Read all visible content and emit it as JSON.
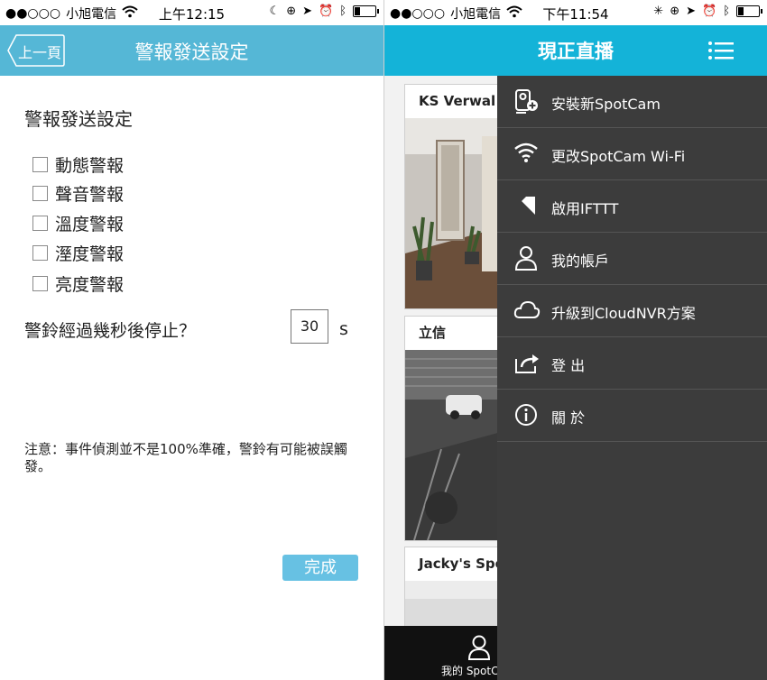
{
  "left": {
    "status": {
      "carrier": "小旭電信",
      "time": "上午12:15"
    },
    "nav": {
      "back": "上一頁",
      "title": "警報發送設定"
    },
    "section_title": "警報發送設定",
    "checkboxes": [
      "動態警報",
      "聲音警報",
      "溫度警報",
      "溼度警報",
      "亮度警報"
    ],
    "stop_question": "警鈴經過幾秒後停止？",
    "seconds_value": "30",
    "seconds_unit": "s",
    "note": "注意：事件偵測並不是100%準確，警鈴有可能被誤觸發。",
    "done": "完成"
  },
  "right": {
    "status": {
      "carrier": "小旭電信",
      "time": "下午11:54"
    },
    "nav": {
      "title": "現正直播"
    },
    "cameras": [
      {
        "title": "KS  Verwal"
      },
      {
        "title": "立信"
      },
      {
        "title": "Jacky's Spo"
      }
    ],
    "bottom_tab": "我的 SpotC",
    "menu": [
      {
        "label": "安裝新SpotCam",
        "icon": "add-camera-icon"
      },
      {
        "label": "更改SpotCam Wi-Fi",
        "icon": "wifi-icon"
      },
      {
        "label": "啟用IFTTT",
        "icon": "ifttt-icon"
      },
      {
        "label": "我的帳戶",
        "icon": "user-icon"
      },
      {
        "label": "升級到CloudNVR方案",
        "icon": "cloud-icon"
      },
      {
        "label": "登 出",
        "icon": "logout-icon"
      },
      {
        "label": "關 於",
        "icon": "info-icon"
      }
    ]
  },
  "colors": {
    "left_nav": "#55b7d6",
    "right_nav": "#14b3d8",
    "drawer": "#3c3c3c",
    "done_button": "#67c1e3"
  }
}
